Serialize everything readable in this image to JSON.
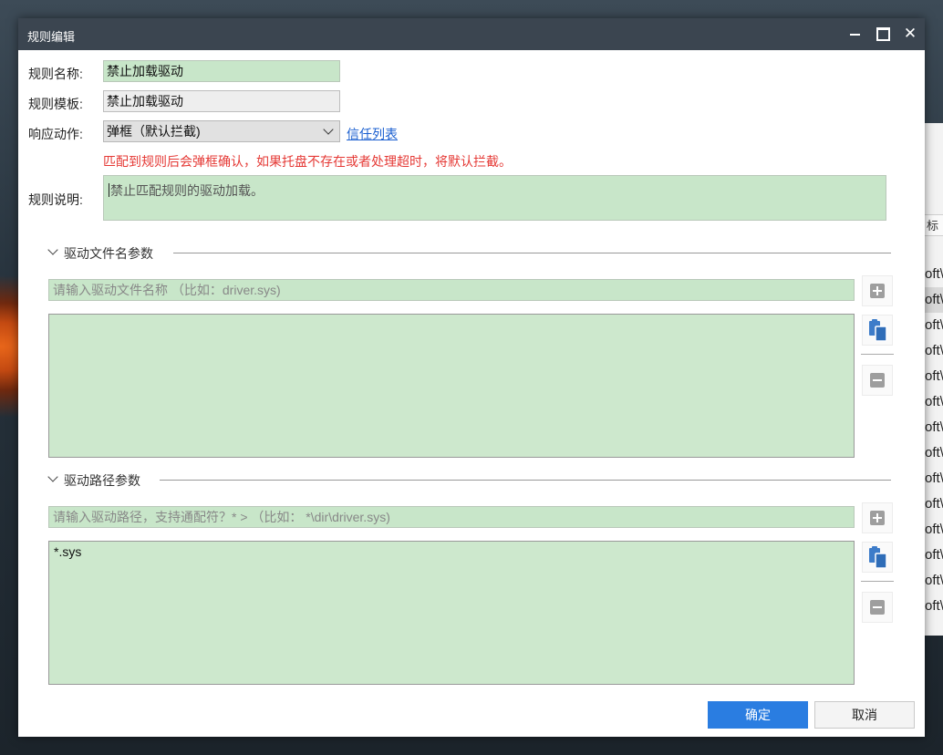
{
  "dialog": {
    "title": "规则编辑",
    "close_symbol": "✕"
  },
  "form": {
    "rule_name_label": "规则名称:",
    "rule_name_value": "禁止加载驱动",
    "rule_template_label": "规则模板:",
    "rule_template_value": "禁止加载驱动",
    "response_label": "响应动作:",
    "response_value": "弹框（默认拦截)",
    "trust_list_link": "信任列表",
    "warning_text": "匹配到规则后会弹框确认，如果托盘不存在或者处理超时，将默认拦截。",
    "desc_label": "规则说明:",
    "desc_value": "禁止匹配规则的驱动加载。"
  },
  "file_section": {
    "title": "驱动文件名参数",
    "placeholder": "请输入驱动文件名称 （比如：driver.sys)",
    "items": []
  },
  "path_section": {
    "title": "驱动路径参数",
    "placeholder": "请输入驱动路径，支持通配符？* > （比如： *\\dir\\driver.sys)",
    "items": [
      "*.sys"
    ]
  },
  "buttons": {
    "ok": "确定",
    "cancel": "取消"
  },
  "background_window": {
    "header": "标",
    "rows": [
      "oft\\",
      "oft\\",
      "oft\\",
      "oft\\",
      "oft\\",
      "oft\\",
      "oft\\",
      "oft\\",
      "oft\\",
      "oft\\",
      "oft\\",
      "oft\\",
      "oft\\",
      "oft\\"
    ]
  },
  "colors": {
    "titlebar": "#3b4550",
    "field_green": "#c8e6c9",
    "primary_button": "#2a7de1",
    "warning_red": "#e53935",
    "link_blue": "#1a5fd0"
  },
  "icons": [
    "minimize-icon",
    "maximize-icon",
    "close-icon",
    "chevron-down-icon",
    "plus-icon",
    "paste-icon",
    "minus-icon"
  ]
}
